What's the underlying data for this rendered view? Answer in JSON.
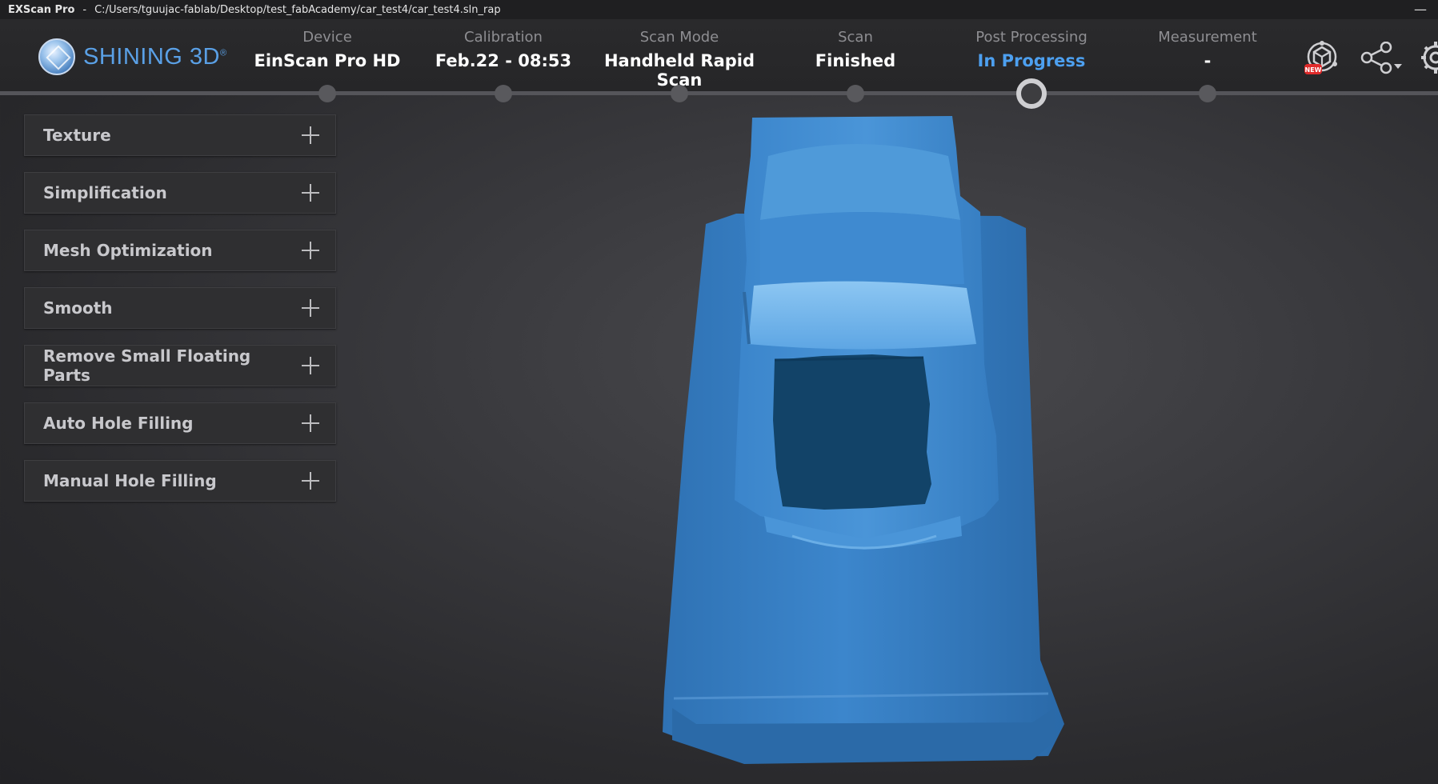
{
  "titlebar": {
    "app": "EXScan Pro",
    "separator": "-",
    "path": "C:/Users/tguujac-fablab/Desktop/test_fabAcademy/car_test4/car_test4.sln_rap",
    "minimize": "—"
  },
  "logo": {
    "text": "SHINING 3D",
    "mark": "®"
  },
  "steps": [
    {
      "label": "Device",
      "value": "EinScan Pro HD"
    },
    {
      "label": "Calibration",
      "value": "Feb.22 - 08:53"
    },
    {
      "label": "Scan Mode",
      "value": "Handheld Rapid Scan"
    },
    {
      "label": "Scan",
      "value": "Finished"
    },
    {
      "label": "Post Processing",
      "value": "In Progress"
    },
    {
      "label": "Measurement",
      "value": "-"
    }
  ],
  "toolbar": {
    "new_badge": "NEW",
    "icons": [
      "3d-model-new-icon",
      "share-icon",
      "settings-icon"
    ]
  },
  "panels": [
    {
      "label": "Texture"
    },
    {
      "label": "Simplification"
    },
    {
      "label": "Mesh Optimization"
    },
    {
      "label": "Smooth"
    },
    {
      "label": "Remove Small Floating Parts"
    },
    {
      "label": "Auto Hole Filling"
    },
    {
      "label": "Manual Hole Filling"
    }
  ],
  "colors": {
    "accent": "#4da0f0",
    "mesh": "#3a80c4",
    "mesh_shadow": "#164770"
  }
}
